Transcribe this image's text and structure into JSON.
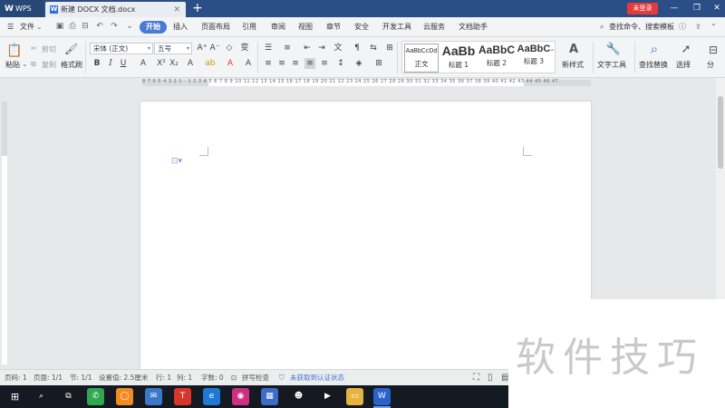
{
  "titlebar": {
    "app_tab": "WPS",
    "doc_tab": "新建 DOCX 文档.docx",
    "login_label": "未登录"
  },
  "menubar": {
    "file_label": "文件",
    "tabs": [
      "开始",
      "插入",
      "页面布局",
      "引用",
      "审阅",
      "视图",
      "章节",
      "安全",
      "开发工具",
      "云服务",
      "文档助手"
    ],
    "search_label": "查找命令、搜索模板"
  },
  "ribbon": {
    "paste_label": "粘贴",
    "cut_label": "剪切",
    "copy_label": "复制",
    "format_painter_label": "格式刷",
    "font_name": "宋体 (正文)",
    "font_size": "五号",
    "styles": [
      {
        "sample": "AaBbCcDd",
        "label": "正文"
      },
      {
        "sample": "AaBb",
        "label": "标题 1"
      },
      {
        "sample": "AaBbC",
        "label": "标题 2"
      },
      {
        "sample": "AaBbC",
        "label": "标题 3"
      }
    ],
    "new_style_label": "新样式",
    "text_tools_label": "文字工具",
    "find_replace_label": "查找替换",
    "select_label": "选择",
    "split_label": "分"
  },
  "statusbar": {
    "page_no": "页码: 1",
    "pages": "页面: 1/1",
    "section": "节: 1/1",
    "set_value": "设置值: 2.5厘米",
    "row": "行: 1",
    "col": "列: 1",
    "word_count": "字数: 0",
    "spell_check": "拼写检查",
    "auth_status": "未获取到认证状态"
  },
  "ruler_numbers": "8 7 6 5 4 3 2 1 · 1 2 3 4 5 6 7 8 9 10 11 12 13 14 15 16 17 18 19 20 21 22 23 24 25 26 27 28 29 30 31 32 33 34 35 36 37 38 39 40 41 42 43 44 45 46 47",
  "watermark": "软件技巧",
  "colors": {
    "title_bar": "#2b4e86",
    "accent_tab": "#4b7ad6",
    "login_red": "#e53b3b",
    "taskbar": "#141922"
  }
}
